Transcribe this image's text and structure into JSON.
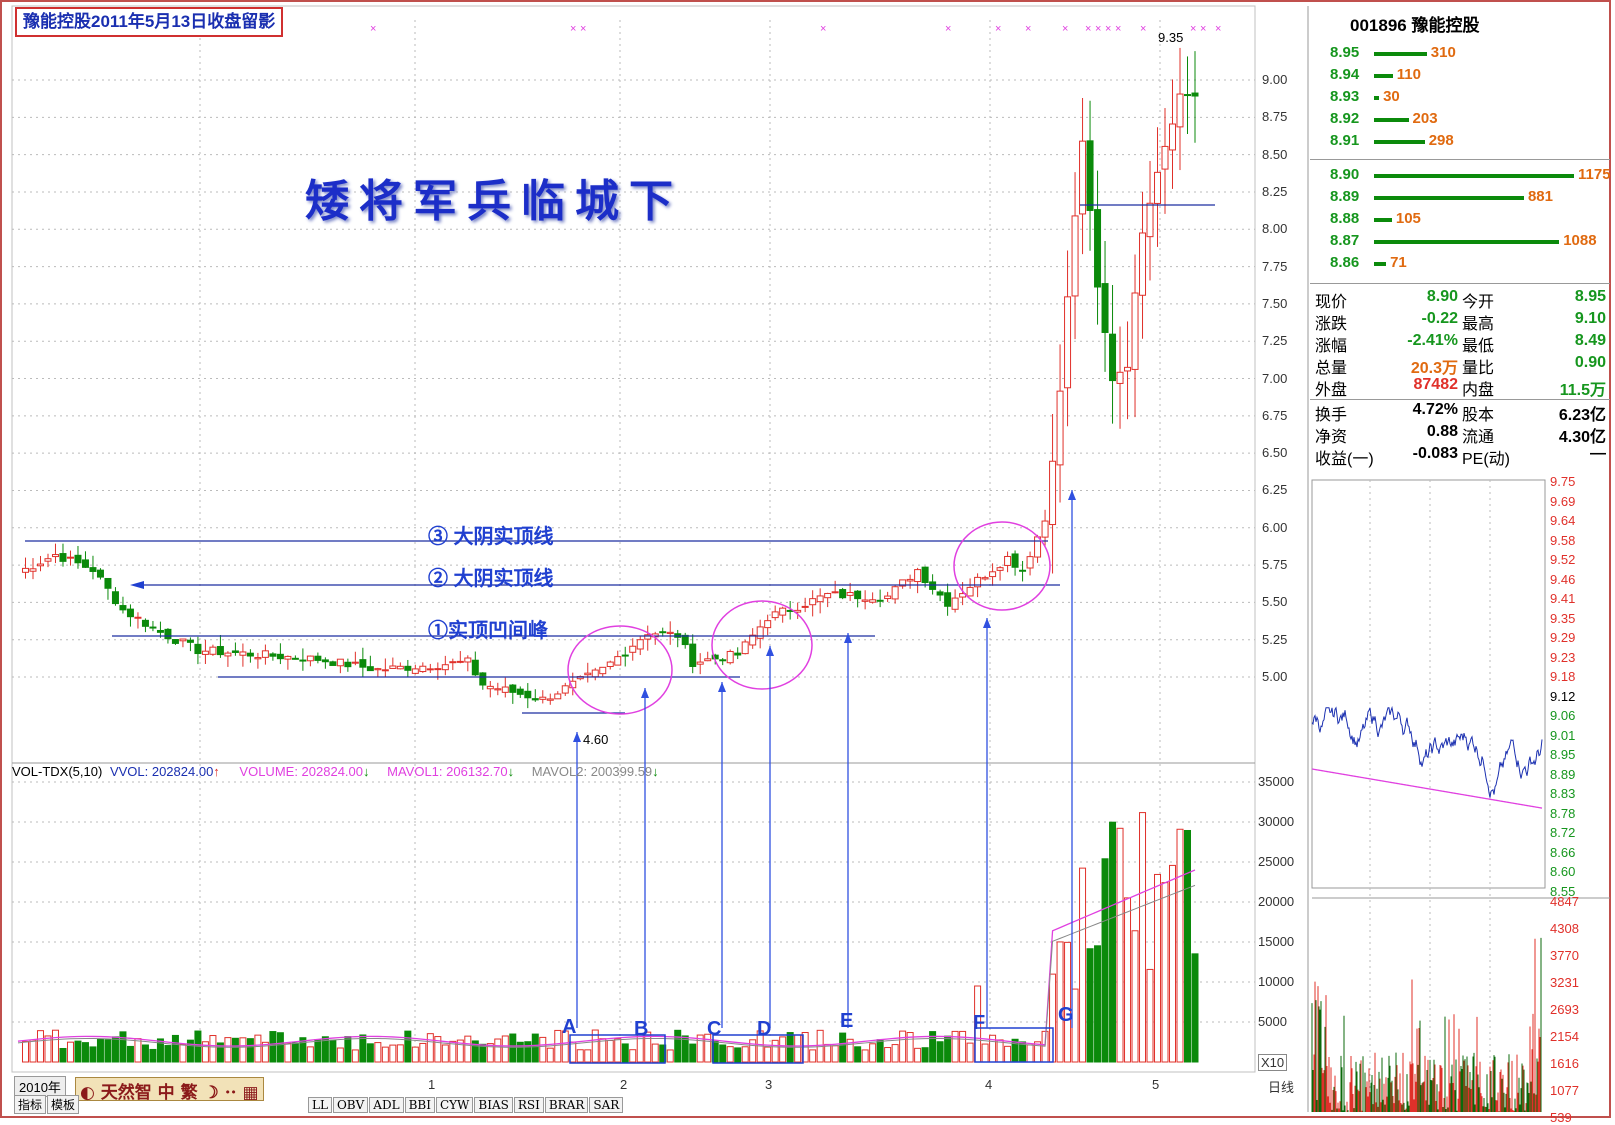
{
  "header": {
    "title": "豫能控股2011年5月13日收盘留影",
    "big_title": "矮将军兵临城下"
  },
  "annotations": {
    "line3": "③ 大阴实顶线",
    "line2": "② 大阴实顶线",
    "line1": "①实顶凹间峰",
    "low_price": "4.60",
    "high_price": "9.35",
    "letters": [
      "A",
      "B",
      "C",
      "D",
      "E",
      "F",
      "G"
    ]
  },
  "price_axis": [
    "9.00",
    "8.75",
    "8.50",
    "8.25",
    "8.00",
    "7.75",
    "7.50",
    "7.25",
    "7.00",
    "6.75",
    "6.50",
    "6.25",
    "6.00",
    "5.75",
    "5.50",
    "5.25",
    "5.00"
  ],
  "volume_axis": [
    "35000",
    "30000",
    "25000",
    "20000",
    "15000",
    "10000",
    "5000"
  ],
  "volume_unit": "X10",
  "time_axis": [
    "2010年",
    "1",
    "2",
    "3",
    "4",
    "5"
  ],
  "period": "日线",
  "volume_legend": {
    "indicator": "VOL-TDX(5,10)",
    "vvol": "VVOL: 202824.00",
    "volume": "VOLUME: 202824.00",
    "mavol1": "MAVOL1: 206132.70",
    "mavol2": "MAVOL2: 200399.59"
  },
  "quote": {
    "code_name": "001896 豫能控股",
    "asks": [
      {
        "price": "8.95",
        "qty": "310"
      },
      {
        "price": "8.94",
        "qty": "110"
      },
      {
        "price": "8.93",
        "qty": "30"
      },
      {
        "price": "8.92",
        "qty": "203"
      },
      {
        "price": "8.91",
        "qty": "298"
      }
    ],
    "bids": [
      {
        "price": "8.90",
        "qty": "1175"
      },
      {
        "price": "8.89",
        "qty": "881"
      },
      {
        "price": "8.88",
        "qty": "105"
      },
      {
        "price": "8.87",
        "qty": "1088"
      },
      {
        "price": "8.86",
        "qty": "71"
      }
    ],
    "stats": [
      {
        "l1": "现价",
        "v1": "8.90",
        "l2": "今开",
        "v2": "8.95"
      },
      {
        "l1": "涨跌",
        "v1": "-0.22",
        "l2": "最高",
        "v2": "9.10"
      },
      {
        "l1": "涨幅",
        "v1": "-2.41%",
        "l2": "最低",
        "v2": "8.49"
      },
      {
        "l1": "总量",
        "v1": "20.3万",
        "l2": "量比",
        "v2": "0.90"
      },
      {
        "l1": "外盘",
        "v1": "87482",
        "l2": "内盘",
        "v2": "11.5万"
      },
      {
        "l1": "换手",
        "v1": "4.72%",
        "l2": "股本",
        "v2": "6.23亿"
      },
      {
        "l1": "净资",
        "v1": "0.88",
        "l2": "流通",
        "v2": "4.30亿"
      },
      {
        "l1": "收益(一)",
        "v1": "-0.083",
        "l2": "PE(动)",
        "v2": "—"
      }
    ]
  },
  "intraday": {
    "price_axis": [
      "9.75",
      "9.69",
      "9.64",
      "9.58",
      "9.52",
      "9.46",
      "9.41",
      "9.35",
      "9.29",
      "9.23",
      "9.18",
      "9.12",
      "9.06",
      "9.01",
      "8.95",
      "8.89",
      "8.83",
      "8.78",
      "8.72",
      "8.66",
      "8.60",
      "8.55"
    ],
    "vol_axis": [
      "4847",
      "4308",
      "3770",
      "3231",
      "2693",
      "2154",
      "1616",
      "1077",
      "539"
    ]
  },
  "bottom_tabs": [
    "指标",
    "模板",
    "LL",
    "OBV",
    "ADL",
    "BBI",
    "CYW",
    "BIAS",
    "RSI",
    "BRAR",
    "SAR"
  ],
  "ime": "天然智 中 繁",
  "colors": {
    "up": "#e0302a",
    "down": "#0b8a0b",
    "annotation": "#2040d0",
    "circle": "#e040e0"
  },
  "chart_data": {
    "type": "candlestick",
    "title": "豫能控股2011年5月13日收盘留影",
    "ylim": [
      4.5,
      9.5
    ],
    "last_bar": {
      "open": 8.95,
      "high": 9.1,
      "low": 8.49,
      "close": 8.9
    },
    "low_marker": 4.6,
    "high_marker": 9.35,
    "volume_ylim": [
      0,
      37000
    ],
    "last_volume": 202824.0
  }
}
